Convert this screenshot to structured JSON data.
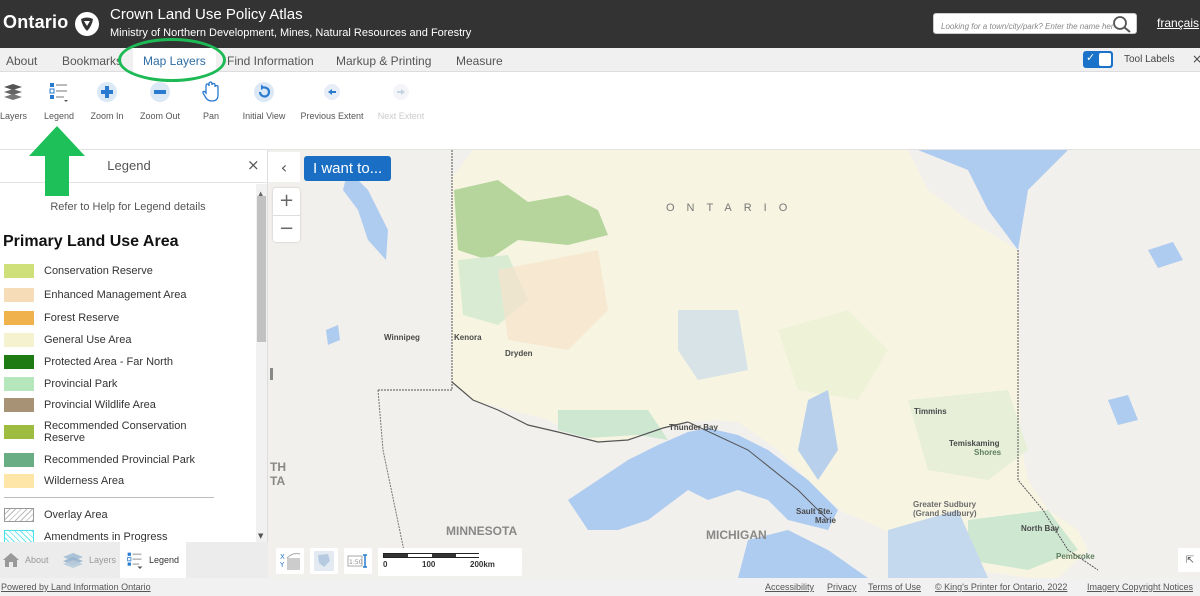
{
  "header": {
    "brand": "Ontario",
    "title": "Crown Land Use Policy Atlas",
    "subtitle": "Ministry of Northern Development, Mines, Natural Resources and Forestry",
    "search_placeholder": "Looking for a town/city/park? Enter the name here",
    "language_link": "français"
  },
  "tabs": [
    {
      "label": "About",
      "active": false
    },
    {
      "label": "Bookmarks",
      "active": false
    },
    {
      "label": "Map Layers",
      "active": true
    },
    {
      "label": "Find Information",
      "active": false
    },
    {
      "label": "Markup & Printing",
      "active": false
    },
    {
      "label": "Measure",
      "active": false
    }
  ],
  "tool_labels": {
    "label": "Tool Labels",
    "checked": true,
    "close": "×"
  },
  "toolbar": [
    {
      "label": "Layers",
      "icon": "layers-icon",
      "enabled": true
    },
    {
      "label": "Legend",
      "icon": "legend-icon",
      "enabled": true
    },
    {
      "label": "Zoom In",
      "icon": "zoom-in-icon",
      "enabled": true
    },
    {
      "label": "Zoom Out",
      "icon": "zoom-out-icon",
      "enabled": true
    },
    {
      "label": "Pan",
      "icon": "hand-icon",
      "enabled": true
    },
    {
      "label": "Initial View",
      "icon": "refresh-icon",
      "enabled": true
    },
    {
      "label": "Previous Extent",
      "icon": "arrow-left-icon",
      "enabled": true
    },
    {
      "label": "Next Extent",
      "icon": "arrow-right-icon",
      "enabled": false
    }
  ],
  "legend_panel": {
    "title": "Legend",
    "close": "×",
    "hint": "Refer to Help for Legend details",
    "heading": "Primary Land Use Area",
    "items": [
      {
        "label": "Conservation Reserve",
        "color": "#cfe07a"
      },
      {
        "label": "Enhanced Management Area",
        "color": "#f7dcb8"
      },
      {
        "label": "Forest Reserve",
        "color": "#efb24c"
      },
      {
        "label": "General Use Area",
        "color": "#f5f2cf"
      },
      {
        "label": "Protected Area - Far North",
        "color": "#1e7a12"
      },
      {
        "label": "Provincial Park",
        "color": "#b5e6bc"
      },
      {
        "label": "Provincial Wildlife Area",
        "color": "#a89276"
      },
      {
        "label": "Recommended Conservation Reserve",
        "color": "#9dbc40"
      },
      {
        "label": "Recommended Provincial Park",
        "color": "#69ad85"
      },
      {
        "label": "Wilderness Area",
        "color": "#fde6a8"
      }
    ],
    "overlay_items": [
      {
        "label": "Overlay Area",
        "pattern": "hatch-gray"
      },
      {
        "label": "Amendments in Progress",
        "pattern": "hatch-cyan"
      }
    ]
  },
  "bottom_tabs": [
    {
      "label": "About",
      "icon": "home-icon",
      "active": false
    },
    {
      "label": "Layers",
      "icon": "layers-icon",
      "active": false
    },
    {
      "label": "Legend",
      "icon": "legend-icon",
      "active": true
    }
  ],
  "map": {
    "i_want_to": "I want to...",
    "collapse": "‹",
    "zoom_in": "+",
    "zoom_out": "−",
    "expand": "⇱",
    "labels": {
      "ontario": "ONTARIO",
      "minnesota": "MINNESOTA",
      "michigan": "MICHIGAN",
      "dakota_partial_1": "TH",
      "dakota_partial_2": "TA",
      "winnipeg": "Winnipeg",
      "kenora": "Kenora",
      "dryden": "Dryden",
      "thunder_bay": "Thunder Bay",
      "timmins": "Timmins",
      "temiskaming_1": "Temiskaming",
      "temiskaming_2": "Shores",
      "sault_1": "Sault Ste.",
      "sault_2": "Marie",
      "sudbury_1": "Greater Sudbury",
      "sudbury_2": "(Grand Sudbury)",
      "north_bay": "North Bay",
      "pembroke": "Pembroke"
    },
    "scale": {
      "t0": "0",
      "t1": "100",
      "t2": "200km"
    }
  },
  "footer": {
    "powered_by": "Powered by Land Information Ontario",
    "links": [
      "Accessibility",
      "Privacy",
      "Terms of Use",
      "© King's Printer for Ontario, 2022",
      "Imagery Copyright Notices"
    ]
  }
}
